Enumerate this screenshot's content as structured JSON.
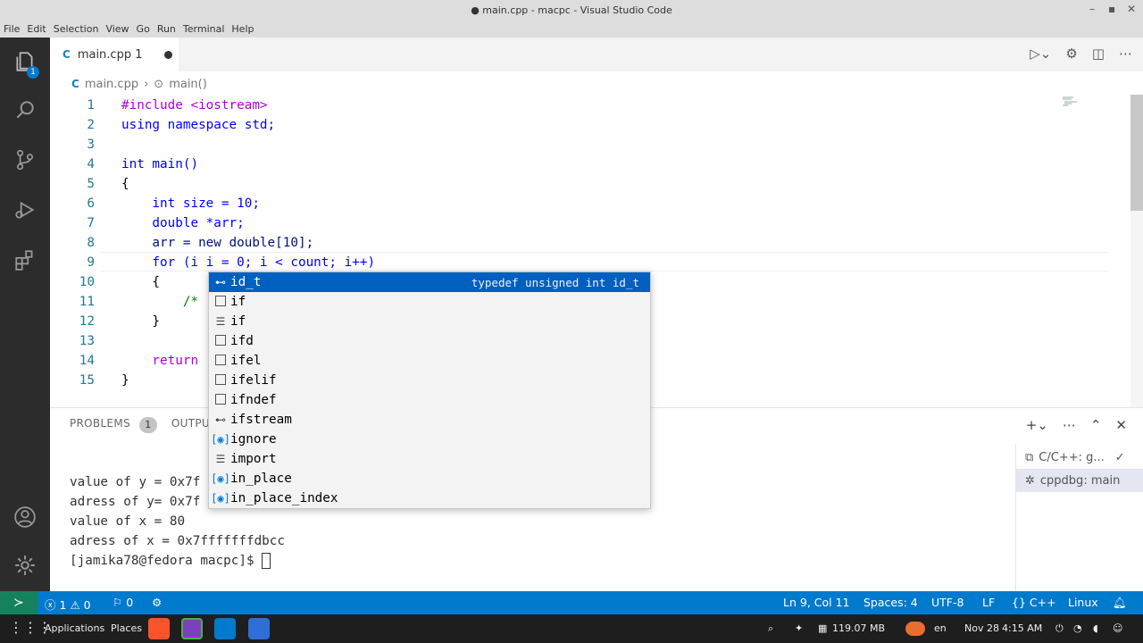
{
  "window": {
    "title": "● main.cpp - macpc - Visual Studio Code"
  },
  "menu": [
    "File",
    "Edit",
    "Selection",
    "View",
    "Go",
    "Run",
    "Terminal",
    "Help"
  ],
  "activity": {
    "explorer_badge": "1"
  },
  "tabs": [
    {
      "label": "main.cpp",
      "problems": "1"
    }
  ],
  "breadcrumb": {
    "file": "main.cpp",
    "symbol": "main()"
  },
  "editor": {
    "line_numbers": [
      "1",
      "2",
      "3",
      "4",
      "5",
      "6",
      "7",
      "8",
      "9",
      "10",
      "11",
      "12",
      "13",
      "14",
      "15"
    ],
    "lines": [
      "#include <iostream>",
      "using namespace std;",
      "",
      "int main()",
      "{",
      "    int size = 10;",
      "    double *arr;",
      "    arr = new double[10];",
      "    for (i i = 0; i < count; i++)",
      "    {",
      "        /*",
      "    }",
      "",
      "    return",
      "}"
    ]
  },
  "suggest": {
    "items": [
      {
        "label": "id_t",
        "icon": "typedef-icon",
        "detail": "typedef unsigned int id_t"
      },
      {
        "label": "if",
        "icon": "snippet-icon"
      },
      {
        "label": "if",
        "icon": "keyword-icon"
      },
      {
        "label": "ifd",
        "icon": "snippet-icon"
      },
      {
        "label": "ifel",
        "icon": "snippet-icon"
      },
      {
        "label": "ifelif",
        "icon": "snippet-icon"
      },
      {
        "label": "ifndef",
        "icon": "snippet-icon"
      },
      {
        "label": "ifstream",
        "icon": "class-icon"
      },
      {
        "label": "ignore",
        "icon": "variable-icon"
      },
      {
        "label": "import",
        "icon": "keyword-icon"
      },
      {
        "label": "in_place",
        "icon": "variable-icon"
      },
      {
        "label": "in_place_index",
        "icon": "variable-icon"
      }
    ]
  },
  "panel": {
    "tabs": {
      "problems": "PROBLEMS",
      "problems_count": "1",
      "output": "OUTPUT"
    },
    "terminal_lines": [
      "value of y = 0x7f",
      "adress of y= 0x7f",
      "value of x = 80",
      "adress of x = 0x7fffffffdbcc",
      "[jamika78@fedora macpc]$ "
    ],
    "terminal_list": [
      "C/C++: g...",
      "cppdbg: main"
    ]
  },
  "statusbar": {
    "errors": "1",
    "warnings": "0",
    "ports": "0",
    "position": "Ln 9, Col 11",
    "spaces": "Spaces: 4",
    "encoding": "UTF-8",
    "eol": "LF",
    "language": "C++",
    "os": "Linux"
  },
  "taskbar": {
    "apps": "Applications",
    "places": "Places",
    "memory": "119.07 MB",
    "lang": "en",
    "date": "Nov 28",
    "time": "4:15 AM"
  },
  "colors": {
    "accent": "#007acc",
    "remote": "#16825d",
    "suggest_sel": "#0060c0"
  }
}
